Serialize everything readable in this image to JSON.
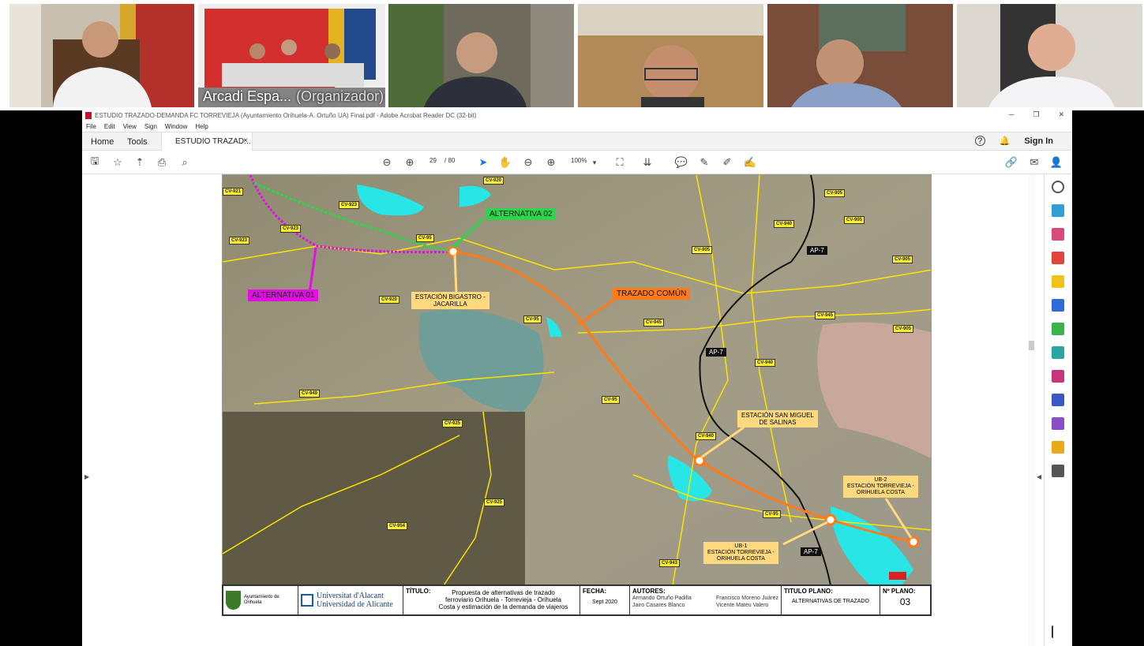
{
  "video": {
    "participants": [
      {
        "name": ""
      },
      {
        "name": "Arcadi Espa...",
        "role": "(Organizador)"
      },
      {
        "name": ""
      },
      {
        "name": ""
      },
      {
        "name": ""
      },
      {
        "name": ""
      }
    ],
    "accent": "#2fa4e7"
  },
  "window": {
    "title": "ESTUDIO TRAZADO-DEMANDA FC TORREVIEJA (Ayuntamiento Orihuela-A. Ortuño  UA) Final.pdf - Adobe Acrobat Reader DC (32-bit)",
    "menu": [
      "File",
      "Edit",
      "View",
      "Sign",
      "Window",
      "Help"
    ]
  },
  "tabs": {
    "home": "Home",
    "tools": "Tools",
    "doc": "ESTUDIO TRAZAD...",
    "close": "×",
    "signin": "Sign In"
  },
  "toolbar": {
    "page_current": "29",
    "page_total": "/ 80",
    "zoom": "100%"
  },
  "map": {
    "alt01": "ALTERNATIVA 01",
    "alt02": "ALTERNATIVA 02",
    "comun": "TRAZADO COMÚN",
    "est1_l1": "ESTACIÓN BIGASTRO -",
    "est1_l2": "JACARILLA",
    "est2_l1": "ESTACIÓN SAN MIGUEL",
    "est2_l2": "DE SALINAS",
    "ub1_l1": "UB-1",
    "ub1_l2": "ESTACIÓN TORREVIEJA -",
    "ub1_l3": "ORIHUELA COSTA",
    "ub2_l1": "UB-2",
    "ub2_l2": "ESTACIÓN TORREVIEJA -",
    "ub2_l3": "ORIHUELA COSTA",
    "roads": {
      "cv921": "CV-921",
      "cv920": "CV-920",
      "cv905a": "CV-905",
      "cv923a": "CV-923",
      "cv923b": "CV-923",
      "cv923c": "CV-923",
      "cv95a": "CV-95",
      "cv940a": "CV-940",
      "cv905b": "CV-905",
      "cv905c": "CV-905",
      "cv905d": "CV-905",
      "cv920b": "CV-920",
      "cv95b": "CV-95",
      "cv945a": "CV-945",
      "cv945b": "CV-945",
      "cv905e": "CV-905",
      "cv940b": "CV-940",
      "cv949": "CV-949",
      "cv95c": "CV-95",
      "cv925a": "CV-925",
      "cv940c": "CV-940",
      "cv925b": "CV-925",
      "cv954": "CV-954",
      "cv95d": "CV-95",
      "cv943": "CV-943"
    },
    "ap7": "AP-7"
  },
  "titleblock": {
    "ayto": "Ayuntamiento de Orihuela",
    "ua1": "Universitat d'Alacant",
    "ua2": "Universidad de Alicante",
    "titulo_lbl": "TÍTULO:",
    "titulo1": "Propuesta de alternativas de trazado",
    "titulo2": "ferroviario Orihuela - Torrevieja - Orihuela",
    "titulo3": "Costa y estimación de la demanda de viajeros",
    "fecha_lbl": "FECHA:",
    "fecha": "Sept 2020",
    "autores_lbl": "AUTORES:",
    "autor1": "Armando Ortuño Padilla",
    "autor2": "Francisco Moreno Juárez",
    "autor3": "Jairo Casares Blanco",
    "autor4": "Vicente Mateu Valero",
    "plano_lbl": "TITULO PLANO:",
    "plano": "ALTERNATIVAS DE TRAZADO",
    "num_lbl": "Nº PLANO:",
    "num": "03"
  }
}
